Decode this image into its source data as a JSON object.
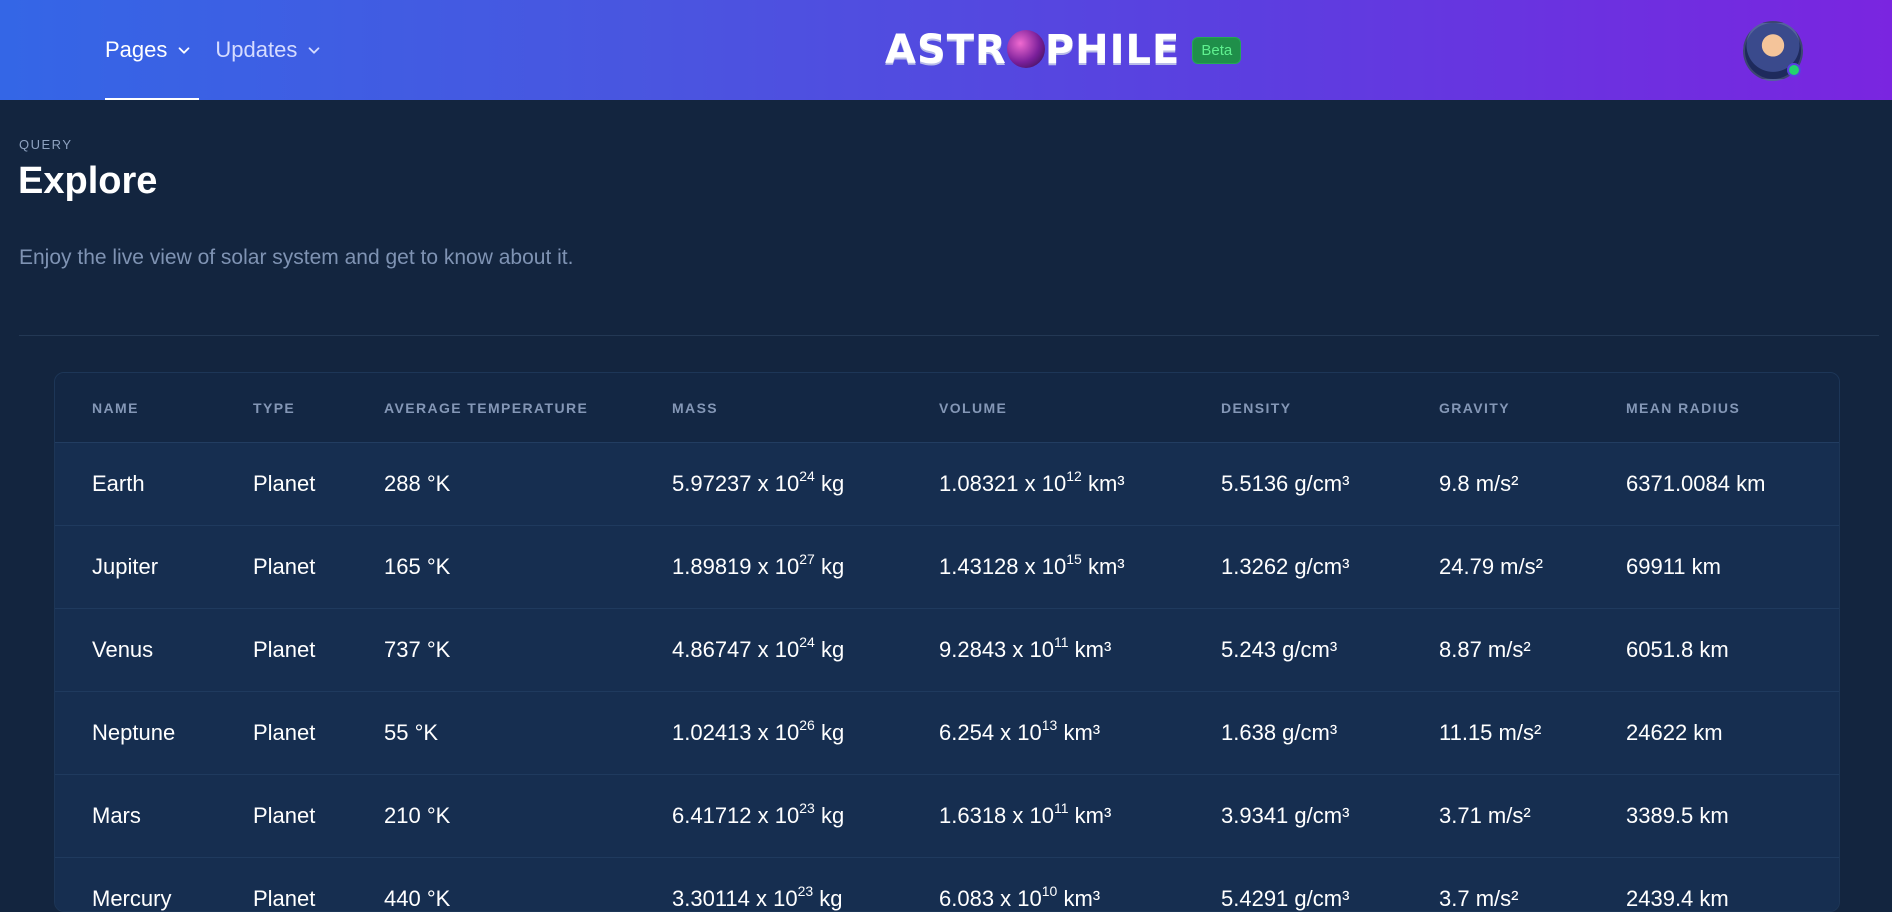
{
  "header": {
    "nav": [
      {
        "label": "Pages",
        "active": true
      },
      {
        "label": "Updates",
        "active": false
      }
    ],
    "brand": {
      "text_left": "ASTR",
      "text_right": "PHILE",
      "badge": "Beta"
    },
    "avatar_status": "online"
  },
  "page": {
    "eyebrow": "QUERY",
    "title": "Explore",
    "subtitle": "Enjoy the live view of solar system and get to know about it."
  },
  "table": {
    "headers": [
      "NAME",
      "TYPE",
      "AVERAGE TEMPERATURE",
      "MASS",
      "VOLUME",
      "DENSITY",
      "GRAVITY",
      "MEAN RADIUS"
    ],
    "rows": [
      {
        "name": "Earth",
        "type": "Planet",
        "temp": "288 °K",
        "mass_base": "5.97237 x 10",
        "mass_exp": "24",
        "mass_unit": "kg",
        "vol_base": "1.08321 x 10",
        "vol_exp": "12",
        "vol_unit": "km³",
        "density": "5.5136 g/cm³",
        "gravity": "9.8 m/s²",
        "radius": "6371.0084 km"
      },
      {
        "name": "Jupiter",
        "type": "Planet",
        "temp": "165 °K",
        "mass_base": "1.89819 x 10",
        "mass_exp": "27",
        "mass_unit": "kg",
        "vol_base": "1.43128 x 10",
        "vol_exp": "15",
        "vol_unit": "km³",
        "density": "1.3262 g/cm³",
        "gravity": "24.79 m/s²",
        "radius": "69911 km"
      },
      {
        "name": "Venus",
        "type": "Planet",
        "temp": "737 °K",
        "mass_base": "4.86747 x 10",
        "mass_exp": "24",
        "mass_unit": "kg",
        "vol_base": "9.2843 x 10",
        "vol_exp": "11",
        "vol_unit": "km³",
        "density": "5.243 g/cm³",
        "gravity": "8.87 m/s²",
        "radius": "6051.8 km"
      },
      {
        "name": "Neptune",
        "type": "Planet",
        "temp": "55 °K",
        "mass_base": "1.02413 x 10",
        "mass_exp": "26",
        "mass_unit": "kg",
        "vol_base": "6.254 x 10",
        "vol_exp": "13",
        "vol_unit": "km³",
        "density": "1.638 g/cm³",
        "gravity": "11.15 m/s²",
        "radius": "24622 km"
      },
      {
        "name": "Mars",
        "type": "Planet",
        "temp": "210 °K",
        "mass_base": "6.41712 x 10",
        "mass_exp": "23",
        "mass_unit": "kg",
        "vol_base": "1.6318 x 10",
        "vol_exp": "11",
        "vol_unit": "km³",
        "density": "3.9341 g/cm³",
        "gravity": "3.71 m/s²",
        "radius": "3389.5 km"
      },
      {
        "name": "Mercury",
        "type": "Planet",
        "temp": "440 °K",
        "mass_base": "3.30114 x 10",
        "mass_exp": "23",
        "mass_unit": "kg",
        "vol_base": "6.083 x 10",
        "vol_exp": "10",
        "vol_unit": "km³",
        "density": "5.4291 g/cm³",
        "gravity": "3.7 m/s²",
        "radius": "2439.4 km"
      }
    ]
  },
  "colors": {
    "header_gradient_start": "#3466e6",
    "header_gradient_end": "#7a25e0",
    "page_bg": "#13253f",
    "table_bg": "#162e50",
    "badge_bg": "#1f8f4a",
    "status_online": "#22d36f"
  },
  "icons": {
    "nav_dropdown": "chevron-down-icon",
    "brand_planet": "planet-icon"
  }
}
